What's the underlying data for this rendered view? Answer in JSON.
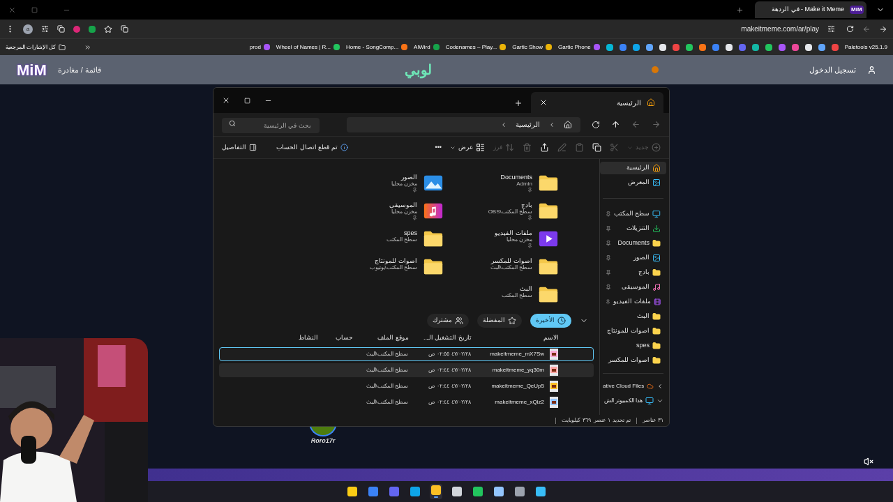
{
  "browser": {
    "tab": {
      "title": "في الردهة - Make it Meme",
      "favicon": "MiM"
    },
    "url": "makeitmeme.com/ar/play",
    "profile_initial": "a",
    "all_bookmarks": "كل الإشارات المرجعية",
    "paletools": "Paletools v25.1.9",
    "icon_bookmarks": [
      {
        "color": "#ef4444"
      },
      {
        "color": "#60a5fa"
      },
      {
        "color": "#e5e7eb"
      },
      {
        "color": "#ec4899"
      },
      {
        "color": "#a855f7"
      },
      {
        "color": "#22c55e"
      },
      {
        "color": "#14b8a6"
      },
      {
        "color": "#6366f1"
      },
      {
        "color": "#e5e7eb"
      },
      {
        "color": "#3b82f6"
      },
      {
        "color": "#f97316"
      },
      {
        "color": "#22c55e"
      },
      {
        "color": "#ef4444"
      },
      {
        "color": "#e5e7eb"
      },
      {
        "color": "#60a5fa"
      },
      {
        "color": "#0ea5e9"
      },
      {
        "color": "#3b82f6"
      },
      {
        "color": "#06b6d4"
      }
    ],
    "bookmarks": [
      {
        "label": "Gartic Phone",
        "color": "#a855f7"
      },
      {
        "label": "Gartic Show",
        "color": "#eab308"
      },
      {
        "label": "Codenames – Play...",
        "color": "#eab308"
      },
      {
        "label": "AlWird",
        "color": "#16a34a"
      },
      {
        "label": "Home - SongComp...",
        "color": "#f97316"
      },
      {
        "label": "Wheel of Names | R...",
        "color": "#22c55e"
      },
      {
        "label": "prod",
        "color": "#a855f7"
      }
    ]
  },
  "site": {
    "logo": "MiM",
    "menu": "قائمة / مغادرة",
    "title": "لوبي",
    "login": "تسجيل الدخول",
    "player": "Roro17r"
  },
  "explorer": {
    "tab": "الرئيسية",
    "breadcrumb": "الرئيسية",
    "search_placeholder": "بحث في الرئيسية",
    "toolbar": [
      {
        "label": "جديد",
        "kind": "new",
        "disabled": true
      },
      {
        "kind": "cut",
        "disabled": true
      },
      {
        "kind": "copy",
        "disabled": false
      },
      {
        "kind": "paste",
        "disabled": true
      },
      {
        "kind": "rename",
        "disabled": true
      },
      {
        "kind": "share",
        "disabled": false
      },
      {
        "kind": "delete",
        "disabled": true
      },
      {
        "label": "فرز",
        "kind": "sort",
        "disabled": true
      },
      {
        "label": "عرض",
        "kind": "view",
        "disabled": false
      },
      {
        "label": "•••",
        "kind": "more",
        "disabled": false
      }
    ],
    "account_status": "تم قطع اتصال الحساب",
    "details": "التفاصيل",
    "quick_access": [
      {
        "name": "Documents",
        "sub": "Admin",
        "kind": "folder",
        "pinned": true
      },
      {
        "name": "الصور",
        "sub": "مخزن محليا",
        "kind": "pictures",
        "pinned": true
      },
      {
        "name": "بادج",
        "sub": "سطح المكتب\\OBS",
        "kind": "folder",
        "pinned": true
      },
      {
        "name": "الموسيقى",
        "sub": "مخزن محليا",
        "kind": "music",
        "pinned": true
      },
      {
        "name": "ملفات الفيديو",
        "sub": "مخزن محليا",
        "kind": "video",
        "pinned": true
      },
      {
        "name": "spes",
        "sub": "سطح المكتب",
        "kind": "folder",
        "pinned": false
      },
      {
        "name": "اصوات للمكسر",
        "sub": "سطح المكتب\\البث",
        "kind": "folder",
        "pinned": false
      },
      {
        "name": "اصوات للمونتاج",
        "sub": "سطح المكتب\\يوتيوب",
        "kind": "folder",
        "pinned": false
      },
      {
        "name": "البث",
        "sub": "سطح المكتب",
        "kind": "folder",
        "pinned": false
      }
    ],
    "filters": [
      {
        "label": "الأخيرة",
        "kind": "recent",
        "selected": true
      },
      {
        "label": "المفضلة",
        "kind": "favorites",
        "selected": false
      },
      {
        "label": "مشترك",
        "kind": "shared",
        "selected": false
      }
    ],
    "columns": [
      "الاسم",
      "تاريخ التشغيل الـ..",
      "موقع الملف",
      "حساب",
      "النشاط"
    ],
    "files": [
      {
        "name": "makeitmeme_mX7Sw",
        "date": "٤٧/٠٢/٢٨ ٠٢:٥٥ ص",
        "location": "سطح المكتب\\البث",
        "selected": true,
        "hovered": false
      },
      {
        "name": "makeitmeme_yq30m",
        "date": "٤٧/٠٢/٢٨ ٠٢:٤٤ ص",
        "location": "سطح المكتب\\البث",
        "selected": false,
        "hovered": true
      },
      {
        "name": "makeitmeme_QeUp5",
        "date": "٤٧/٠٢/٢٨ ٠٢:٤٤ ص",
        "location": "سطح المكتب\\البث",
        "selected": false,
        "hovered": false
      },
      {
        "name": "makeitmeme_xQiz2",
        "date": "٤٧/٠٢/٢٨ ٠٢:٤٤ ص",
        "location": "سطح المكتب\\البث",
        "selected": false,
        "hovered": false
      }
    ],
    "sidebar": [
      {
        "label": "الرئيسية",
        "kind": "home",
        "pinned": false,
        "selected": true
      },
      {
        "label": "المعرض",
        "kind": "gallery",
        "pinned": false,
        "selected": false
      },
      {
        "label": "سطح المكتب",
        "kind": "desktop",
        "pinned": true,
        "selected": false
      },
      {
        "label": "التنزيلات",
        "kind": "downloads",
        "pinned": true,
        "selected": false
      },
      {
        "label": "Documents",
        "kind": "folder",
        "pinned": true,
        "selected": false
      },
      {
        "label": "الصور",
        "kind": "pictures",
        "pinned": true,
        "selected": false
      },
      {
        "label": "بادج",
        "kind": "folder",
        "pinned": true,
        "selected": false
      },
      {
        "label": "الموسيقى",
        "kind": "music",
        "pinned": true,
        "selected": false
      },
      {
        "label": "ملفات الفيديو",
        "kind": "video",
        "pinned": true,
        "selected": false
      },
      {
        "label": "البث",
        "kind": "folder",
        "pinned": false,
        "selected": false
      },
      {
        "label": "اصوات للمونتاج",
        "kind": "folder",
        "pinned": false,
        "selected": false
      },
      {
        "label": "spes",
        "kind": "folder",
        "pinned": false,
        "selected": false
      },
      {
        "label": "اصوات للمكسر",
        "kind": "folder",
        "pinned": false,
        "selected": false
      }
    ],
    "drives": [
      {
        "label": "ative Cloud Files",
        "kind": "cloud",
        "expanded": false
      },
      {
        "label": "هذا الكمبيوتر الش",
        "kind": "pc",
        "expanded": true
      }
    ],
    "status": {
      "count": "٣١ عناصر",
      "selection": "تم تحديد ١ عنصر  ٣٦٩ كيلوبايت"
    }
  },
  "taskbar": [
    {
      "color": "#facc15",
      "selected": false
    },
    {
      "color": "#3b82f6",
      "selected": false
    },
    {
      "color": "#6366f1",
      "selected": false
    },
    {
      "color": "#0ea5e9",
      "selected": false
    },
    {
      "color": "#fbbf24",
      "selected": true
    },
    {
      "color": "#d1d5db",
      "selected": false
    },
    {
      "color": "#22c55e",
      "selected": false
    },
    {
      "color": "#93c5fd",
      "selected": false
    },
    {
      "color": "#9ca3af",
      "selected": false
    },
    {
      "color": "#38bdf8",
      "selected": false
    }
  ]
}
